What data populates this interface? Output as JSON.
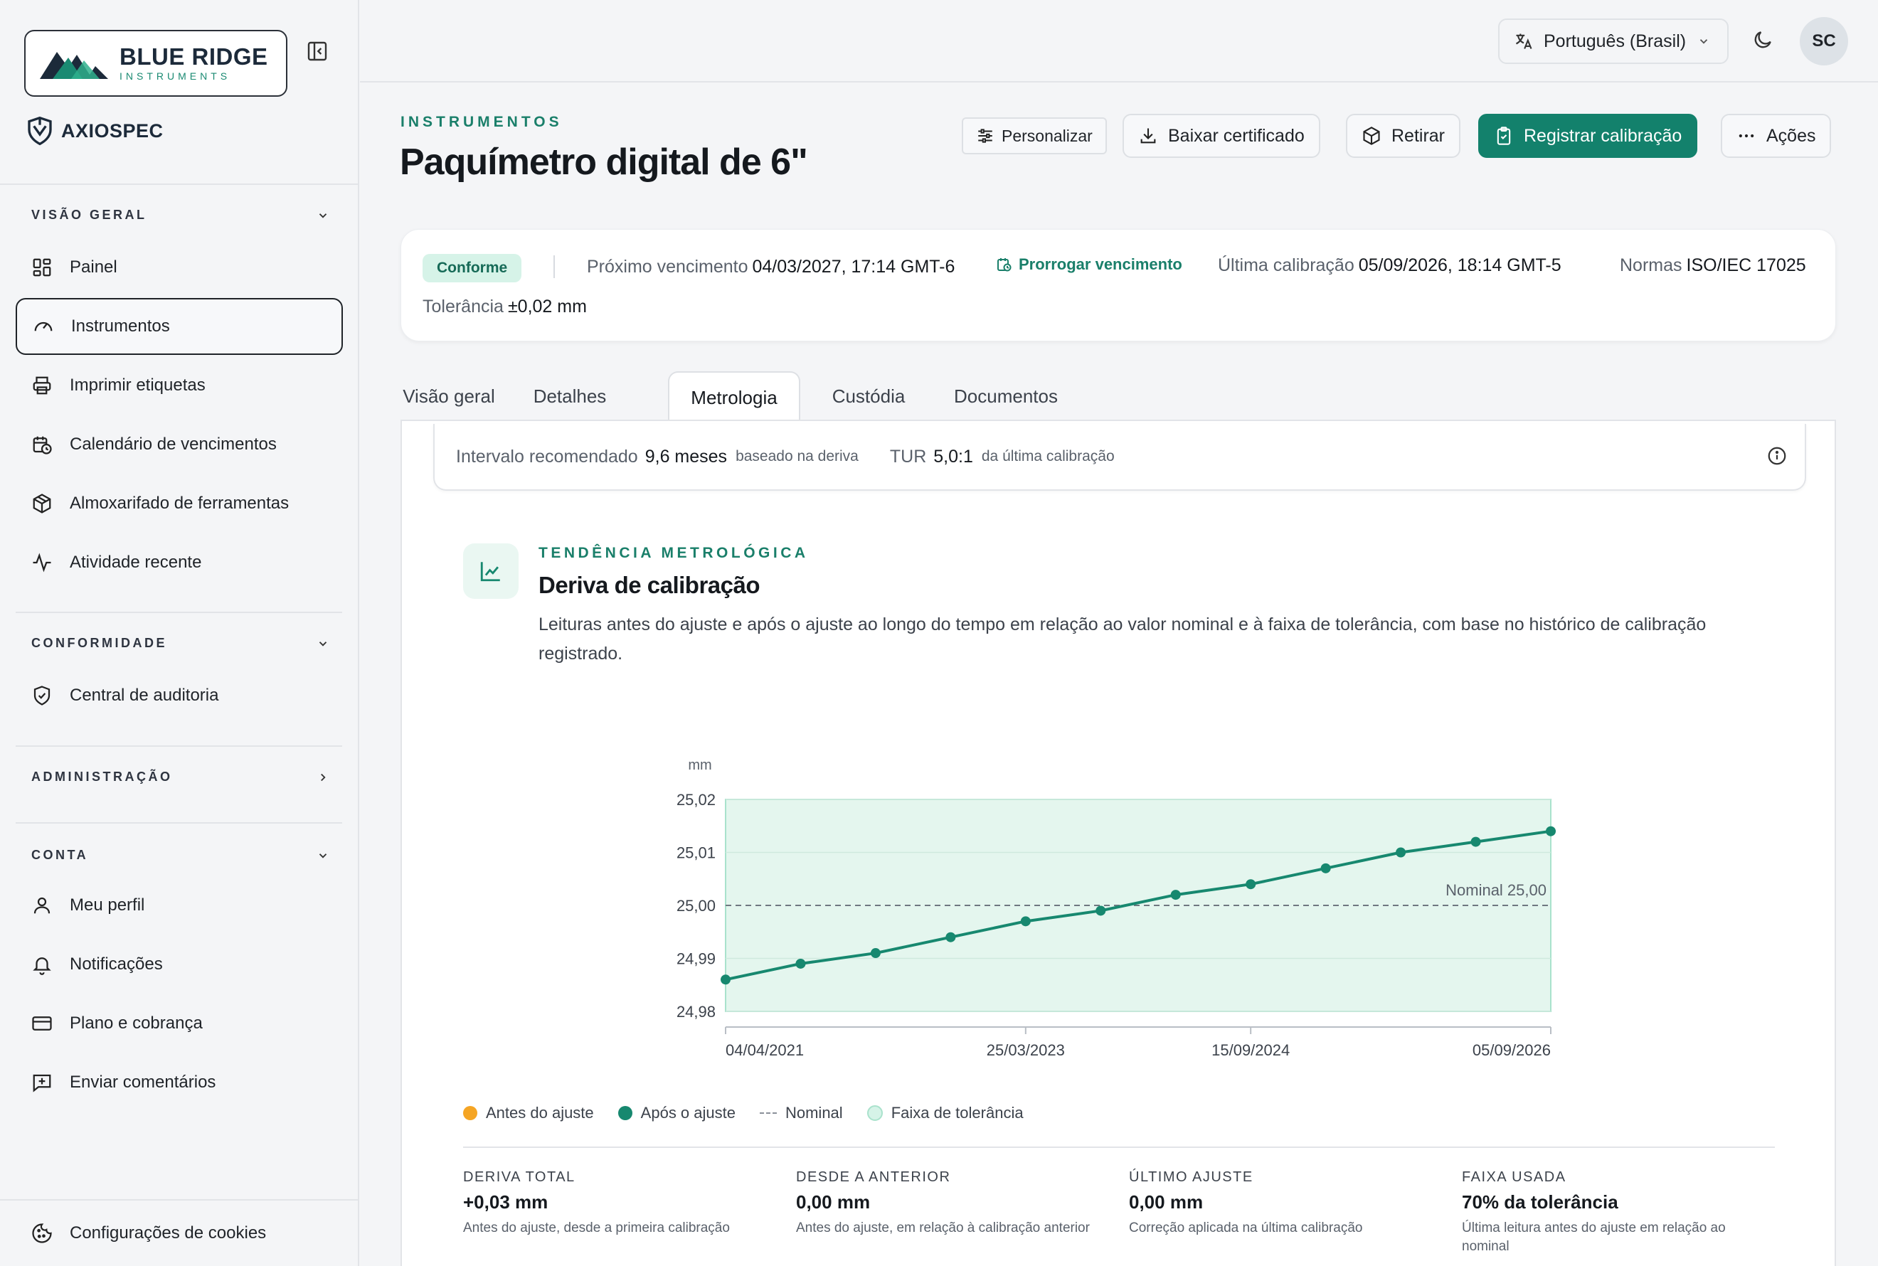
{
  "sidebar": {
    "logo": {
      "name": "BLUE RIDGE",
      "sub": "INSTRUMENTS"
    },
    "product": "AXIOSPEC",
    "sections": [
      {
        "title": "VISÃO GERAL",
        "items": [
          "Painel",
          "Instrumentos",
          "Imprimir etiquetas",
          "Calendário de vencimentos",
          "Almoxarifado de ferramentas",
          "Atividade recente"
        ]
      },
      {
        "title": "CONFORMIDADE",
        "items": [
          "Central de auditoria"
        ]
      },
      {
        "title": "ADMINISTRAÇÃO",
        "items": []
      },
      {
        "title": "CONTA",
        "items": [
          "Meu perfil",
          "Notificações",
          "Plano e cobrança",
          "Enviar comentários"
        ]
      }
    ],
    "active_item": "Instrumentos",
    "footer": "Configurações de cookies"
  },
  "topbar": {
    "language": "Português (Brasil)",
    "avatar": "SC"
  },
  "header": {
    "eyebrow": "INSTRUMENTOS",
    "title": "Paquímetro digital de 6\"",
    "actions": {
      "customize": "Personalizar",
      "download": "Baixar certificado",
      "retire": "Retirar",
      "register": "Registrar calibração",
      "more": "Ações"
    }
  },
  "status": {
    "badge": "Conforme",
    "next_due_label": "Próximo vencimento",
    "next_due": "04/03/2027, 17:14 GMT-6",
    "extend": "Prorrogar vencimento",
    "last_cal_label": "Última calibração",
    "last_cal": "05/09/2026, 18:14 GMT-5",
    "standards_label": "Normas",
    "standards": "ISO/IEC 17025",
    "tolerance_label": "Tolerância",
    "tolerance": "±0,02 mm"
  },
  "tabs": [
    "Visão geral",
    "Detalhes",
    "Metrologia",
    "Custódia",
    "Documentos"
  ],
  "active_tab": "Metrologia",
  "interval": {
    "label": "Intervalo recomendado",
    "value": "9,6 meses",
    "note": "baseado na deriva",
    "tur_label": "TUR",
    "tur_value": "5,0:1",
    "tur_note": "da última calibração"
  },
  "trend": {
    "eyebrow": "TENDÊNCIA METROLÓGICA",
    "title": "Deriva de calibração",
    "description": "Leituras antes do ajuste e após o ajuste ao longo do tempo em relação ao valor nominal e à faixa de tolerância, com base no histórico de calibração registrado."
  },
  "chart_data": {
    "type": "line",
    "ylabel": "mm",
    "ylim": [
      24.98,
      25.02
    ],
    "yticks": [
      "25,02",
      "25,01",
      "25,00",
      "24,99",
      "24,98"
    ],
    "ytick_values": [
      25.02,
      25.01,
      25.0,
      24.99,
      24.98
    ],
    "xticks": [
      "04/04/2021",
      "25/03/2023",
      "15/09/2024",
      "05/09/2026"
    ],
    "xtick_index": [
      0,
      4,
      7,
      11
    ],
    "nominal": 25.0,
    "nominal_label": "Nominal 25,00",
    "tolerance_band": [
      24.98,
      25.02
    ],
    "series": [
      {
        "name": "Após o ajuste",
        "color": "#17886f",
        "values": [
          24.986,
          24.989,
          24.991,
          24.994,
          24.997,
          24.999,
          25.002,
          25.004,
          25.007,
          25.01,
          25.012,
          25.014
        ]
      }
    ],
    "legend": [
      {
        "label": "Antes do ajuste",
        "color": "#f5a524",
        "kind": "dot"
      },
      {
        "label": "Após o ajuste",
        "color": "#17886f",
        "kind": "dot"
      },
      {
        "label": "Nominal",
        "color": "#8a9099",
        "kind": "dash"
      },
      {
        "label": "Faixa de tolerância",
        "color": "#d6f3e8",
        "kind": "band"
      }
    ]
  },
  "stats": [
    {
      "label": "DERIVA TOTAL",
      "value": "+0,03 mm",
      "desc": "Antes do ajuste, desde a primeira calibração"
    },
    {
      "label": "DESDE A ANTERIOR",
      "value": "0,00 mm",
      "desc": "Antes do ajuste, em relação à calibração anterior"
    },
    {
      "label": "ÚLTIMO AJUSTE",
      "value": "0,00 mm",
      "desc": "Correção aplicada na última calibração"
    },
    {
      "label": "FAIXA USADA",
      "value": "70% da tolerância",
      "desc": "Última leitura antes do ajuste em relação ao nominal"
    }
  ]
}
